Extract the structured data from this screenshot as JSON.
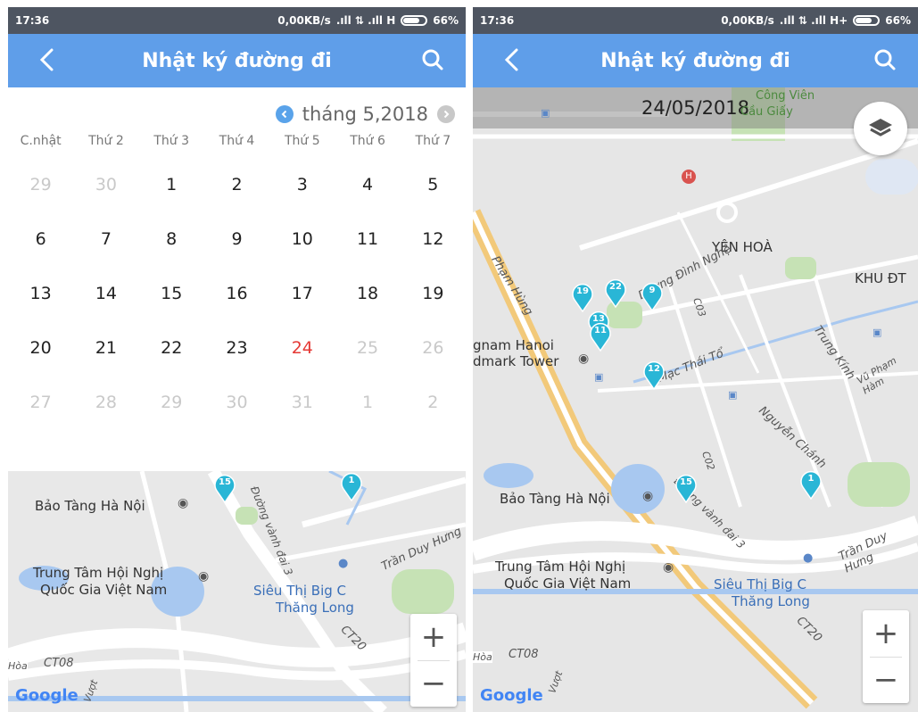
{
  "left": {
    "status": {
      "time": "17:36",
      "network": "0,00KB/s",
      "signal": ".ıll ⇅ .ıll H",
      "battery": "66%"
    },
    "appbar": {
      "title": "Nhật ký đường đi",
      "back_icon": "chevron-left-icon",
      "search_icon": "search-icon"
    },
    "calendar": {
      "month_label": "tháng 5,2018",
      "weekdays": [
        "C.nhật",
        "Thứ 2",
        "Thứ 3",
        "Thứ 4",
        "Thứ 5",
        "Thứ 6",
        "Thứ 7"
      ],
      "days": [
        {
          "d": "29",
          "state": "muted"
        },
        {
          "d": "30",
          "state": "muted"
        },
        {
          "d": "1",
          "state": "normal"
        },
        {
          "d": "2",
          "state": "normal"
        },
        {
          "d": "3",
          "state": "normal"
        },
        {
          "d": "4",
          "state": "normal"
        },
        {
          "d": "5",
          "state": "normal"
        },
        {
          "d": "6",
          "state": "normal"
        },
        {
          "d": "7",
          "state": "normal"
        },
        {
          "d": "8",
          "state": "normal"
        },
        {
          "d": "9",
          "state": "normal"
        },
        {
          "d": "10",
          "state": "normal"
        },
        {
          "d": "11",
          "state": "normal"
        },
        {
          "d": "12",
          "state": "normal"
        },
        {
          "d": "13",
          "state": "normal"
        },
        {
          "d": "14",
          "state": "normal"
        },
        {
          "d": "15",
          "state": "normal"
        },
        {
          "d": "16",
          "state": "normal"
        },
        {
          "d": "17",
          "state": "normal"
        },
        {
          "d": "18",
          "state": "normal"
        },
        {
          "d": "19",
          "state": "normal"
        },
        {
          "d": "20",
          "state": "normal"
        },
        {
          "d": "21",
          "state": "normal"
        },
        {
          "d": "22",
          "state": "normal"
        },
        {
          "d": "23",
          "state": "normal"
        },
        {
          "d": "24",
          "state": "today"
        },
        {
          "d": "25",
          "state": "muted"
        },
        {
          "d": "26",
          "state": "muted"
        },
        {
          "d": "27",
          "state": "muted"
        },
        {
          "d": "28",
          "state": "muted"
        },
        {
          "d": "29",
          "state": "muted"
        },
        {
          "d": "30",
          "state": "muted"
        },
        {
          "d": "31",
          "state": "muted"
        },
        {
          "d": "1",
          "state": "muted"
        },
        {
          "d": "2",
          "state": "muted"
        }
      ]
    },
    "map": {
      "labels": {
        "bao_tang": "Bảo Tàng Hà Nội",
        "trung_tam_1": "Trung Tâm Hội Nghị",
        "trung_tam_2": "Quốc Gia Việt Nam",
        "sieu_thi_1": "Siêu Thị Big C",
        "sieu_thi_2": "Thăng Long",
        "tran_duy_hung": "Trần Duy Hưng",
        "ct20": "CT20",
        "ct08": "CT08",
        "vanh_dai": "Đường vành đai 3",
        "hoa": "Hòa",
        "vuot": "Vượt"
      },
      "pins": [
        {
          "n": "15"
        },
        {
          "n": "1"
        }
      ],
      "zoom_in": "+",
      "zoom_out": "−",
      "google": "Google"
    }
  },
  "right": {
    "status": {
      "time": "17:36",
      "network": "0,00KB/s",
      "signal": ".ıll ⇅ .ıll H+",
      "battery": "66%"
    },
    "appbar": {
      "title": "Nhật ký đường đi",
      "back_icon": "chevron-left-icon",
      "search_icon": "search-icon"
    },
    "map": {
      "date": "24/05/2018",
      "labels": {
        "cong_vien": "Công Viên",
        "cau_giay": "Cầu Giấy",
        "yen_hoa": "YÊN HOÀ",
        "khu_dt": "KHU ĐT",
        "pham_hung": "Phạm Hùng",
        "duong_dinh_nghe": "Dương Đình Nghệ",
        "c03": "C03",
        "trung_kinh": "Trung Kính",
        "landmark_1": "gnam Hanoi",
        "landmark_2": "dmark Tower",
        "mac_thai_to": "Mạc Thái Tổ",
        "vu_pham_ham": "Vũ Phạm Hàm",
        "nguyen_chanh": "Nguyễn Chánh",
        "c02": "C02",
        "bao_tang": "Bảo Tàng Hà Nội",
        "vanh_dai": "Đường vành đai 3",
        "trung_tam_1": "Trung Tâm Hội Nghị",
        "trung_tam_2": "Quốc Gia Việt Nam",
        "sieu_thi_1": "Siêu Thị Big C",
        "sieu_thi_2": "Thăng Long",
        "tran_duy_hung": "Trần Duy Hưng",
        "ct20": "CT20",
        "ct08": "CT08",
        "hoa": "Hòa",
        "vuot": "Vượt"
      },
      "pins": [
        {
          "n": "19"
        },
        {
          "n": "22"
        },
        {
          "n": "9"
        },
        {
          "n": "13"
        },
        {
          "n": "11"
        },
        {
          "n": "12"
        },
        {
          "n": "15"
        },
        {
          "n": "1"
        }
      ],
      "zoom_in": "+",
      "zoom_out": "−",
      "google": "Google"
    }
  },
  "colors": {
    "appbar": "#5f9ee9",
    "status": "#4e5561",
    "pin": "#29b6d6",
    "today": "#e53935"
  }
}
